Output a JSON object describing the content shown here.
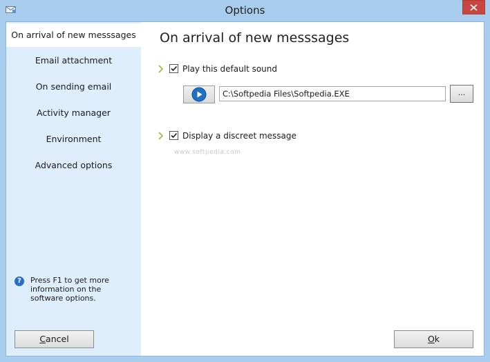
{
  "window": {
    "title": "Options"
  },
  "sidebar": {
    "items": [
      {
        "label": "On arrival of new messsages",
        "active": true
      },
      {
        "label": "Email attachment"
      },
      {
        "label": "On sending email"
      },
      {
        "label": "Activity manager"
      },
      {
        "label": "Environment"
      },
      {
        "label": "Advanced options"
      }
    ],
    "help_text": "Press F1 to get more information on the software options.",
    "cancel_label_pre": "",
    "cancel_label_ul": "C",
    "cancel_label_post": "ancel"
  },
  "main": {
    "title": "On arrival of new messsages",
    "play_sound": {
      "label": "Play this default sound",
      "checked": true
    },
    "sound_path": "C:\\Softpedia Files\\Softpedia.EXE",
    "browse_label": "...",
    "discreet": {
      "label": "Display a discreet message",
      "checked": true
    },
    "watermark": "www.softpedia.com",
    "ok_label_ul": "O",
    "ok_label_post": "k"
  },
  "colors": {
    "frame": "#a9cdee",
    "sidebar_bg": "#dfeefc",
    "close_red": "#c7463f",
    "play_blue": "#1f6fc5"
  }
}
